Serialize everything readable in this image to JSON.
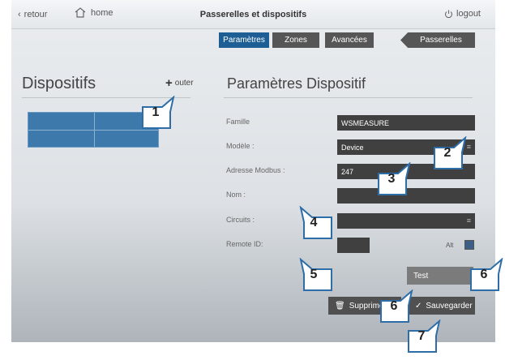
{
  "topbar": {
    "back_label": "retour",
    "home_label": "home",
    "title": "Passerelles et dispositifs",
    "logout_label": "logout"
  },
  "tabs": {
    "parametres": "Paramètres",
    "zones": "Zones",
    "avancees": "Avancées",
    "passerelles": "Passerelles"
  },
  "left_panel": {
    "title": "Dispositifs",
    "add_label": "outer"
  },
  "right_panel": {
    "title": "Paramètres Dispositif",
    "fields": {
      "famille": {
        "label": "Famille",
        "value": "WSMEASURE"
      },
      "modele": {
        "label": "Modèle :",
        "value": "Device"
      },
      "adresse": {
        "label": "Adresse Modbus :",
        "value": "247"
      },
      "nom": {
        "label": "Nom :",
        "value": ""
      },
      "circuits": {
        "label": "Circuits :",
        "value": ""
      },
      "remote": {
        "label": "Remote ID:",
        "value": ""
      }
    },
    "alt_label": "Alt",
    "test_label": "Test",
    "delete_label": "Supprimer",
    "save_label": "Sauvegarder"
  },
  "callouts": [
    "1",
    "2",
    "3",
    "4",
    "5",
    "6",
    "6",
    "7"
  ],
  "colors": {
    "accent_blue": "#1d5f95",
    "tab_gray": "#565656",
    "field_dark": "#404040",
    "device_row": "#3d7aab"
  }
}
